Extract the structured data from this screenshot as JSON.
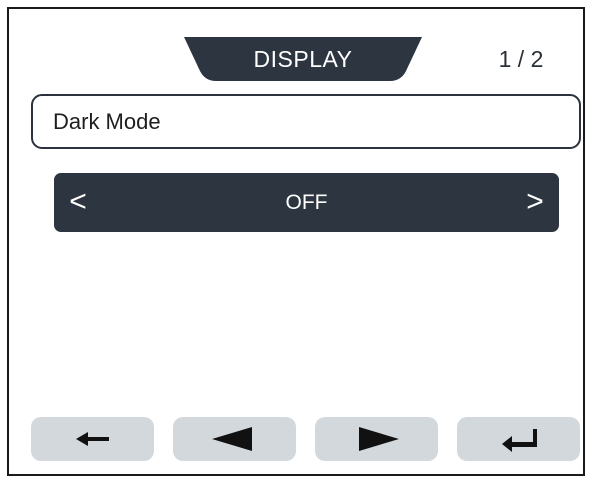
{
  "header": {
    "title": "DISPLAY",
    "page_indicator": "1 / 2"
  },
  "setting": {
    "label": "Dark Mode",
    "value": "OFF",
    "prev_symbol": "<",
    "next_symbol": ">"
  },
  "nav_buttons": [
    {
      "icon": "back-arrow-icon"
    },
    {
      "icon": "previous-triangle-icon"
    },
    {
      "icon": "next-triangle-icon"
    },
    {
      "icon": "enter-return-icon"
    }
  ],
  "colors": {
    "dark": "#2d3540",
    "button_bg": "#d3d8dd",
    "border": "#1a1a1a",
    "text_on_dark": "#ffffff"
  }
}
